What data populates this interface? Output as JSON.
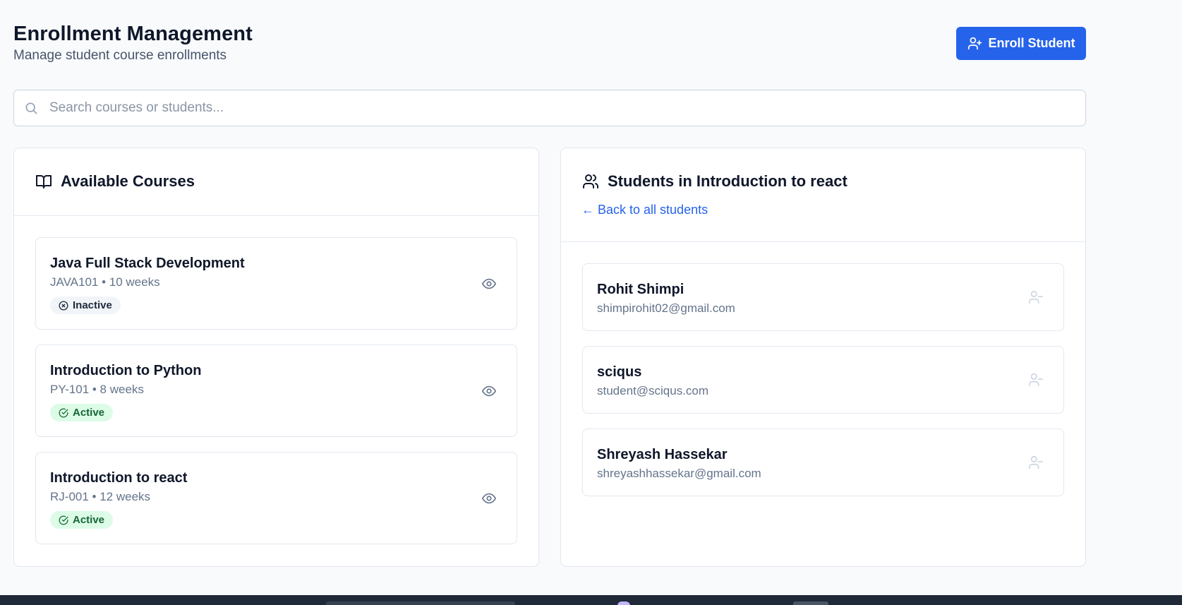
{
  "header": {
    "title": "Enrollment Management",
    "subtitle": "Manage student course enrollments",
    "enroll_button": "Enroll Student"
  },
  "search": {
    "placeholder": "Search courses or students...",
    "value": ""
  },
  "courses_panel": {
    "title": "Available Courses",
    "icon": "book-open-icon",
    "courses": [
      {
        "name": "Java Full Stack Development",
        "meta": "JAVA101 • 10 weeks",
        "status": "Inactive"
      },
      {
        "name": "Introduction to Python",
        "meta": "PY-101 • 8 weeks",
        "status": "Active"
      },
      {
        "name": "Introduction to react",
        "meta": "RJ-001 • 12 weeks",
        "status": "Active"
      }
    ]
  },
  "students_panel": {
    "title": "Students in Introduction to react",
    "icon": "users-icon",
    "back_link": "← Back to all students",
    "students": [
      {
        "name": "Rohit Shimpi",
        "email": "shimpirohit02@gmail.com"
      },
      {
        "name": "sciqus",
        "email": "student@sciqus.com"
      },
      {
        "name": "Shreyash Hassekar",
        "email": "shreyashhassekar@gmail.com"
      }
    ]
  },
  "colors": {
    "accent": "#2563eb",
    "active_badge_bg": "#dcfce7",
    "active_badge_text": "#166534",
    "inactive_badge_bg": "#f1f5f9"
  }
}
